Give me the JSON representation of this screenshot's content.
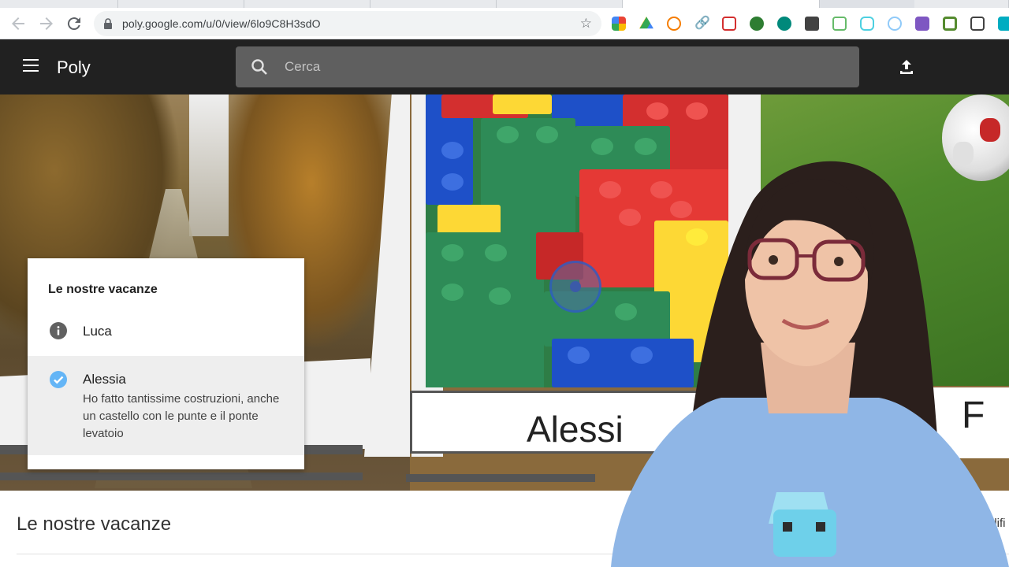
{
  "browser": {
    "url": "poly.google.com/u/0/view/6lo9C8H3sdO",
    "back_icon": "arrow-left-icon",
    "forward_icon": "arrow-right-icon",
    "reload_icon": "reload-icon",
    "star_icon": "star-icon"
  },
  "app": {
    "brand": "Poly",
    "search_placeholder": "Cerca"
  },
  "scene": {
    "card_caption_center": "Alessi",
    "card_caption_right": "F"
  },
  "popup": {
    "title": "Le nostre vacanze",
    "items": [
      {
        "name": "Luca",
        "icon": "info-icon",
        "selected": false,
        "description": ""
      },
      {
        "name": "Alessia",
        "icon": "check-circle-icon",
        "selected": true,
        "description": "Ho fatto tantissime costruzioni, anche un castello con le punte e il ponte levatoio"
      }
    ]
  },
  "bottom": {
    "tour_title": "Le nostre vacanze",
    "edit_label_partial": "odifi"
  },
  "colors": {
    "appbar": "#212121",
    "searchbar": "#5f5f5f",
    "check_blue": "#64b5f6"
  }
}
